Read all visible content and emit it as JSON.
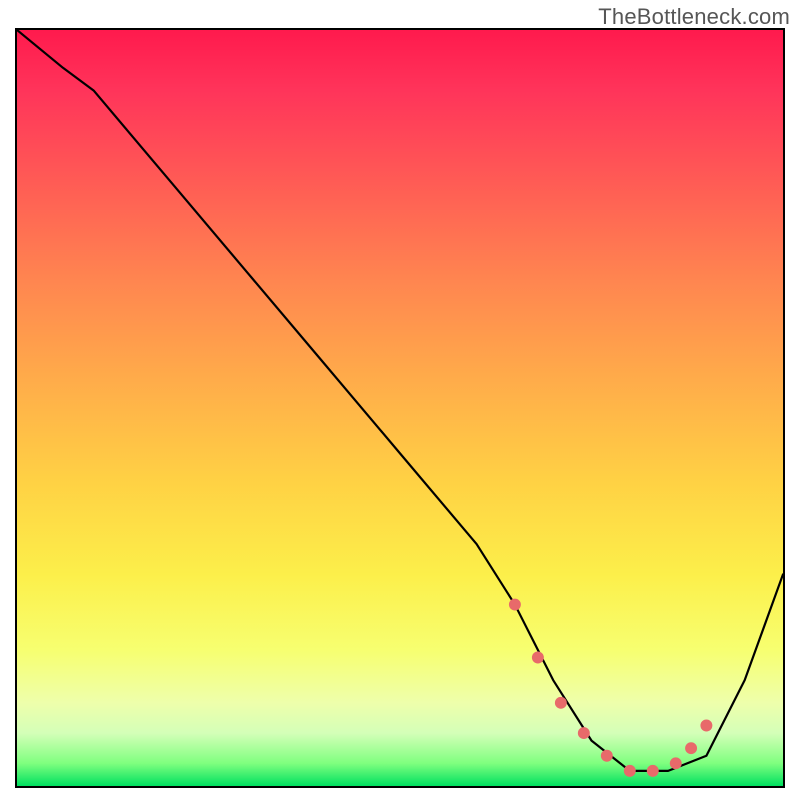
{
  "attribution": "TheBottleneck.com",
  "chart_data": {
    "type": "line",
    "title": "",
    "xlabel": "",
    "ylabel": "",
    "xlim": [
      0,
      100
    ],
    "ylim": [
      0,
      100
    ],
    "series": [
      {
        "name": "bottleneck-curve",
        "x": [
          0,
          6,
          10,
          20,
          30,
          40,
          50,
          60,
          65,
          70,
          75,
          80,
          85,
          90,
          95,
          100
        ],
        "values": [
          100,
          95,
          92,
          80,
          68,
          56,
          44,
          32,
          24,
          14,
          6,
          2,
          2,
          4,
          14,
          28
        ]
      }
    ],
    "markers": {
      "name": "highlight-dots",
      "color": "#e86a6a",
      "x": [
        65,
        68,
        71,
        74,
        77,
        80,
        83,
        86,
        88,
        90
      ],
      "values": [
        24,
        17,
        11,
        7,
        4,
        2,
        2,
        3,
        5,
        8
      ]
    },
    "gradient_stops": [
      {
        "pos": 0,
        "color": "#ff1a4d"
      },
      {
        "pos": 20,
        "color": "#ff5b55"
      },
      {
        "pos": 46,
        "color": "#ffab4a"
      },
      {
        "pos": 72,
        "color": "#fcef4a"
      },
      {
        "pos": 89,
        "color": "#eeffab"
      },
      {
        "pos": 100,
        "color": "#00e060"
      }
    ]
  }
}
